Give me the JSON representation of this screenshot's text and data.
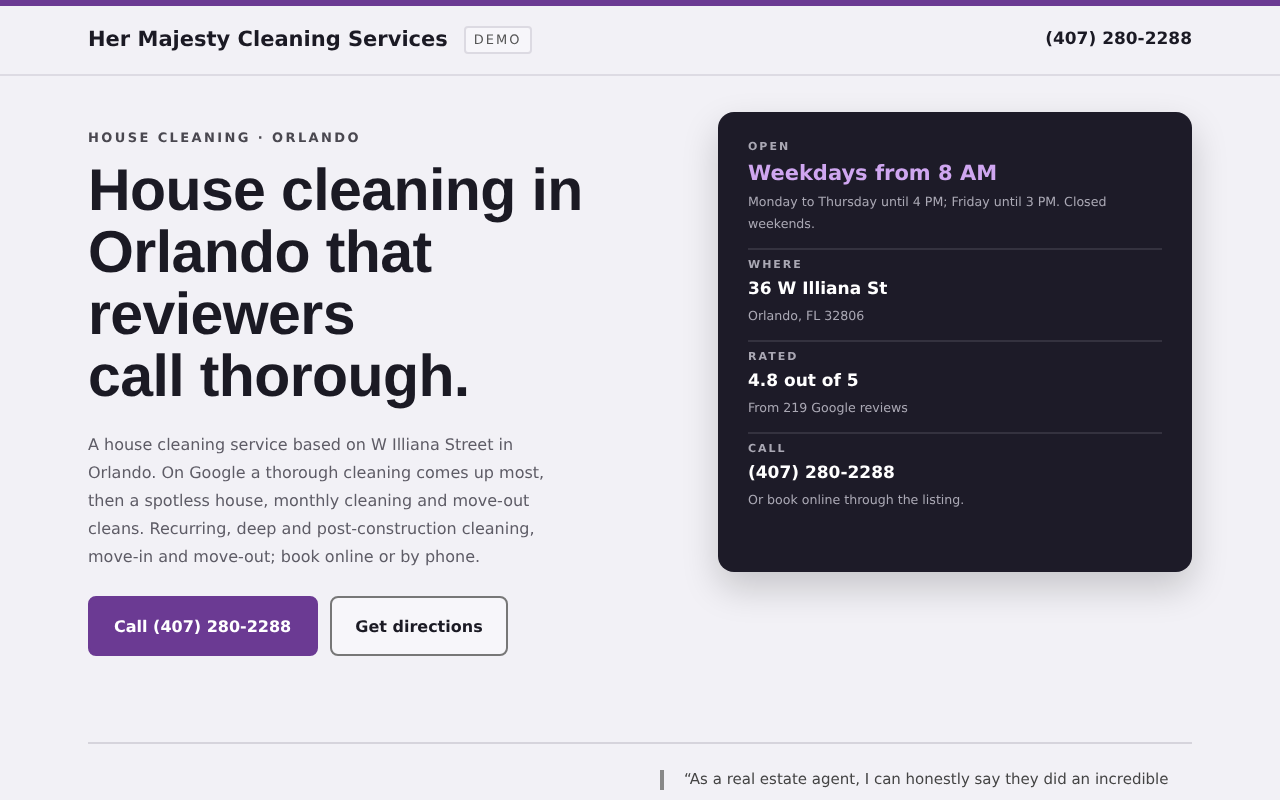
{
  "header": {
    "brand": "Her Majesty Cleaning Services",
    "badge": "DEMO",
    "phone": "(407) 280-2288"
  },
  "hero": {
    "eyebrow": "HOUSE CLEANING · ORLANDO",
    "headline_lines": [
      "House cleaning in",
      "Orlando that",
      "reviewers",
      "call thorough."
    ],
    "description": "A house cleaning service based on W Illiana Street in Orlando. On Google a thorough cleaning comes up most, then a spotless house, monthly cleaning and move-out cleans. Recurring, deep and post-construction cleaning, move-in and move-out; book online or by phone.",
    "buttons": [
      {
        "label": "Call (407) 280-2288",
        "kind": "primary"
      },
      {
        "label": "Get directions",
        "kind": "secondary"
      }
    ]
  },
  "info_card": [
    {
      "label": "OPEN",
      "value": "Weekdays from 8 AM",
      "note": "Monday to Thursday until 4 PM; Friday until 3 PM. Closed weekends.",
      "kind": "accent"
    },
    {
      "label": "WHERE",
      "value": "36 W Illiana St",
      "note": "Orlando, FL 32806",
      "kind": "plain"
    },
    {
      "label": "RATED",
      "value": "4.8 out of 5",
      "note": "From 219 Google reviews",
      "kind": "plain"
    },
    {
      "label": "CALL",
      "value": "(407) 280-2288",
      "note": "Or book online through the listing.",
      "kind": "plain"
    }
  ],
  "quote": "“As a real estate agent, I can honestly say they did an incredible"
}
